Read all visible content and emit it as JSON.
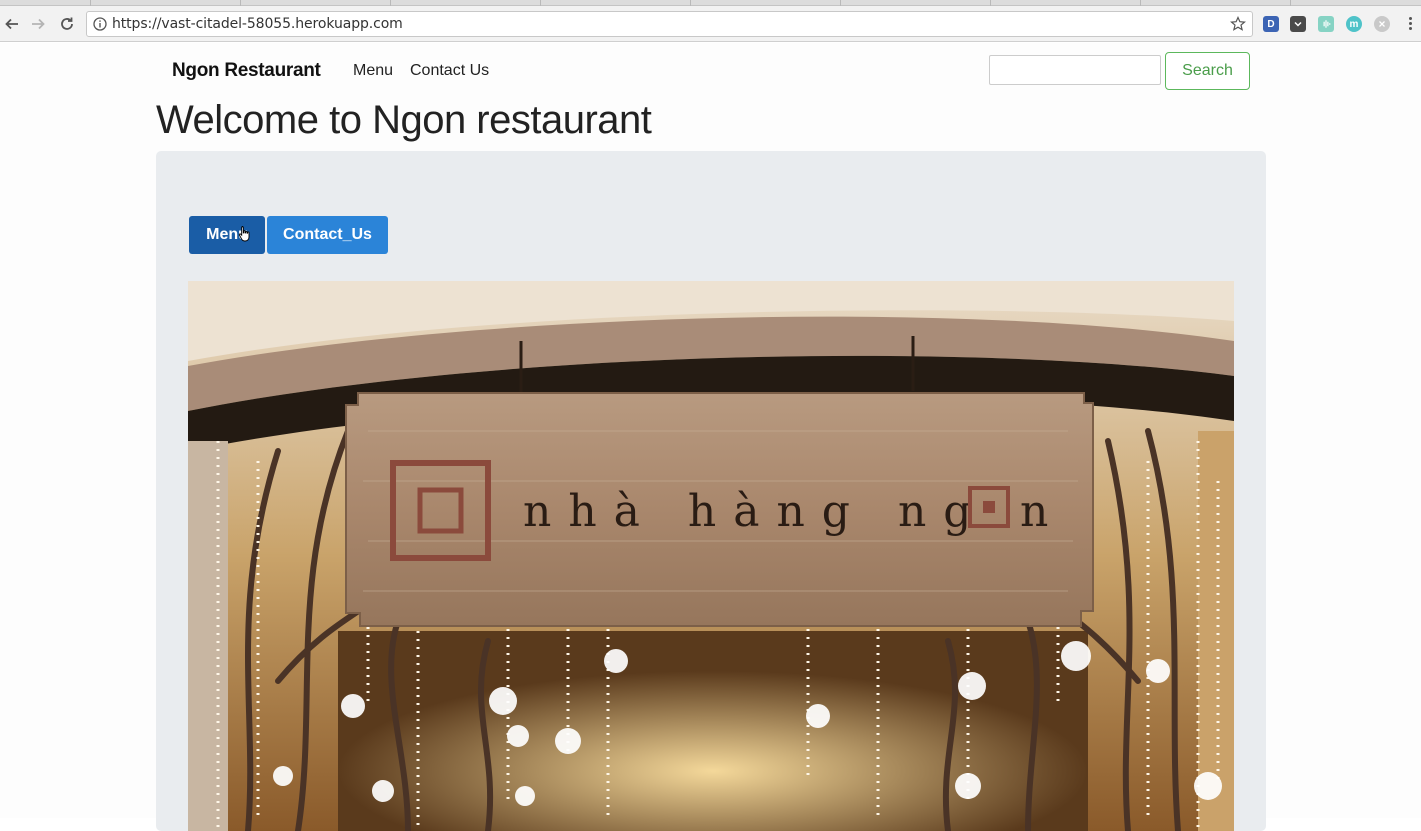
{
  "browser": {
    "url": "https://vast-citadel-58055.herokuapp.com",
    "extensions": [
      {
        "name": "D",
        "color": "#3c64b4"
      },
      {
        "name": "pocket",
        "color": "#444"
      },
      {
        "name": "wave",
        "color": "#86d3c4"
      },
      {
        "name": "m",
        "color": "#4fc3c9"
      },
      {
        "name": "x",
        "color": "#c9c9c9"
      }
    ]
  },
  "navbar": {
    "brand": "Ngon Restaurant",
    "links": [
      "Menu",
      "Contact Us"
    ],
    "search_placeholder": "",
    "search_button": "Search"
  },
  "main": {
    "title": "Welcome to Ngon restaurant",
    "buttons": [
      "Menu",
      "Contact_Us"
    ],
    "hero": {
      "sign_text": "nhà hàng ngon",
      "accent": "#8b4a3c"
    }
  },
  "colors": {
    "primary_dark": "#1a5da6",
    "primary": "#2b84d8",
    "success": "#5cb85c",
    "jumbotron": "#e9ecef"
  }
}
